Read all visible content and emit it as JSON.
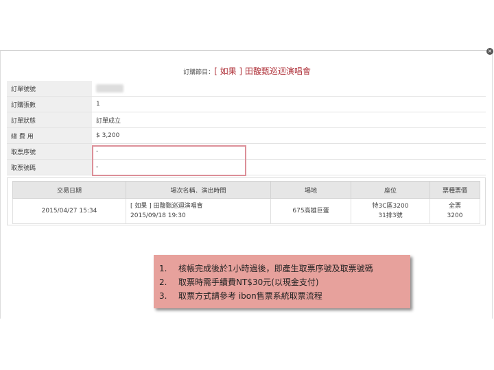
{
  "order_title": {
    "prefix": "訂購節目：",
    "name": "[ 如果 ] 田馥甄巡迴演唱會"
  },
  "info_rows": [
    {
      "label": "訂單號號",
      "value": ""
    },
    {
      "label": "訂購張數",
      "value": "1"
    },
    {
      "label": "訂單狀態",
      "value": "訂單成立"
    },
    {
      "label": "總 費 用",
      "value": "$ 3,200"
    },
    {
      "label": "取票序號",
      "value": "-"
    },
    {
      "label": "取票號碼",
      "value": "-"
    }
  ],
  "transactions": {
    "headers": [
      "交易日期",
      "場次名稱．演出時間",
      "場地",
      "座位",
      "票種票價"
    ],
    "rows": [
      {
        "date": "2015/04/27 15:34",
        "event_name": "[ 如果 ] 田馥甄巡迴演唱會",
        "event_time": "2015/09/18 19:30",
        "venue": "675高雄巨蛋",
        "seat_line1": "特3C區3200",
        "seat_line2": "31排3號",
        "ticket_type": "全票",
        "price": "3200"
      }
    ]
  },
  "notes": [
    {
      "num": "1.",
      "text": "核帳完成後於1小時過後，即產生取票序號及取票號碼"
    },
    {
      "num": "2.",
      "text": "取票時需手續費NT$30元(以現金支付)"
    },
    {
      "num": "3.",
      "text": "取票方式請參考 ibon售票系統取票流程"
    }
  ]
}
